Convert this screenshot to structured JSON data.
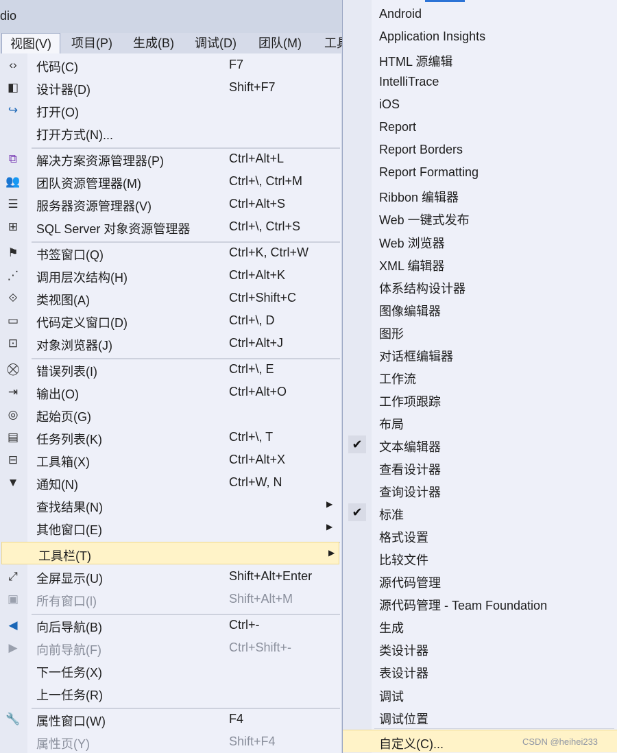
{
  "titlebar": {
    "title": "dio"
  },
  "menubar": {
    "items": [
      "视图(V)",
      "项目(P)",
      "生成(B)",
      "调试(D)",
      "团队(M)",
      "工具"
    ]
  },
  "view_menu": {
    "items": [
      {
        "icon": "code-icon",
        "label": "代码(C)",
        "shortcut": "F7"
      },
      {
        "icon": "designer-icon",
        "label": "设计器(D)",
        "shortcut": "Shift+F7"
      },
      {
        "icon": "open-icon",
        "label": "打开(O)",
        "shortcut": ""
      },
      {
        "icon": "",
        "label": "打开方式(N)...",
        "shortcut": ""
      },
      {
        "icon": "solution-explorer-icon",
        "label": "解决方案资源管理器(P)",
        "shortcut": "Ctrl+Alt+L"
      },
      {
        "icon": "team-explorer-icon",
        "label": "团队资源管理器(M)",
        "shortcut": "Ctrl+\\, Ctrl+M"
      },
      {
        "icon": "server-explorer-icon",
        "label": "服务器资源管理器(V)",
        "shortcut": "Ctrl+Alt+S"
      },
      {
        "icon": "sql-server-icon",
        "label": "SQL Server 对象资源管理器",
        "shortcut": "Ctrl+\\, Ctrl+S"
      },
      {
        "icon": "bookmark-icon",
        "label": "书签窗口(Q)",
        "shortcut": "Ctrl+K, Ctrl+W"
      },
      {
        "icon": "call-hierarchy-icon",
        "label": "调用层次结构(H)",
        "shortcut": "Ctrl+Alt+K"
      },
      {
        "icon": "class-view-icon",
        "label": "类视图(A)",
        "shortcut": "Ctrl+Shift+C"
      },
      {
        "icon": "code-definition-icon",
        "label": "代码定义窗口(D)",
        "shortcut": "Ctrl+\\, D"
      },
      {
        "icon": "object-browser-icon",
        "label": "对象浏览器(J)",
        "shortcut": "Ctrl+Alt+J"
      },
      {
        "icon": "error-list-icon",
        "label": "错误列表(I)",
        "shortcut": "Ctrl+\\, E"
      },
      {
        "icon": "output-icon",
        "label": "输出(O)",
        "shortcut": "Ctrl+Alt+O"
      },
      {
        "icon": "start-page-icon",
        "label": "起始页(G)",
        "shortcut": ""
      },
      {
        "icon": "task-list-icon",
        "label": "任务列表(K)",
        "shortcut": "Ctrl+\\, T"
      },
      {
        "icon": "toolbox-icon",
        "label": "工具箱(X)",
        "shortcut": "Ctrl+Alt+X"
      },
      {
        "icon": "notification-icon",
        "label": "通知(N)",
        "shortcut": "Ctrl+W, N"
      },
      {
        "icon": "",
        "label": "查找结果(N)",
        "shortcut": "",
        "submenu": true
      },
      {
        "icon": "",
        "label": "其他窗口(E)",
        "shortcut": "",
        "submenu": true
      },
      {
        "icon": "",
        "label": "工具栏(T)",
        "shortcut": "",
        "submenu": true,
        "selected": true
      },
      {
        "icon": "fullscreen-icon",
        "label": "全屏显示(U)",
        "shortcut": "Shift+Alt+Enter"
      },
      {
        "icon": "all-windows-icon",
        "label": "所有窗口(l)",
        "shortcut": "Shift+Alt+M",
        "disabled": true
      },
      {
        "icon": "navigate-back-icon",
        "label": "向后导航(B)",
        "shortcut": "Ctrl+-"
      },
      {
        "icon": "navigate-forward-icon",
        "label": "向前导航(F)",
        "shortcut": "Ctrl+Shift+-",
        "disabled": true
      },
      {
        "icon": "",
        "label": "下一任务(X)",
        "shortcut": ""
      },
      {
        "icon": "",
        "label": "上一任务(R)",
        "shortcut": ""
      },
      {
        "icon": "properties-icon",
        "label": "属性窗口(W)",
        "shortcut": "F4"
      },
      {
        "icon": "",
        "label": "属性页(Y)",
        "shortcut": "Shift+F4",
        "disabled": true
      }
    ]
  },
  "toolbars_submenu": {
    "items": [
      {
        "label": "Android"
      },
      {
        "label": "Application Insights"
      },
      {
        "label": "HTML 源编辑"
      },
      {
        "label": "IntelliTrace"
      },
      {
        "label": "iOS"
      },
      {
        "label": "Report"
      },
      {
        "label": "Report Borders"
      },
      {
        "label": "Report Formatting"
      },
      {
        "label": "Ribbon 编辑器"
      },
      {
        "label": "Web 一键式发布"
      },
      {
        "label": "Web 浏览器"
      },
      {
        "label": "XML 编辑器"
      },
      {
        "label": "体系结构设计器"
      },
      {
        "label": "图像编辑器"
      },
      {
        "label": "图形"
      },
      {
        "label": "对话框编辑器"
      },
      {
        "label": "工作流"
      },
      {
        "label": "工作项跟踪"
      },
      {
        "label": "布局"
      },
      {
        "label": "文本编辑器",
        "checked": true
      },
      {
        "label": "查看设计器"
      },
      {
        "label": "查询设计器"
      },
      {
        "label": "标准",
        "checked": true
      },
      {
        "label": "格式设置"
      },
      {
        "label": "比较文件"
      },
      {
        "label": "源代码管理"
      },
      {
        "label": "源代码管理 - Team Foundation"
      },
      {
        "label": "生成"
      },
      {
        "label": "类设计器"
      },
      {
        "label": "表设计器"
      },
      {
        "label": "调试"
      },
      {
        "label": "调试位置"
      },
      {
        "label": "自定义(C)...",
        "selected": true
      }
    ],
    "check_glyph": "✔"
  },
  "watermark": "CSDN @heihei233"
}
